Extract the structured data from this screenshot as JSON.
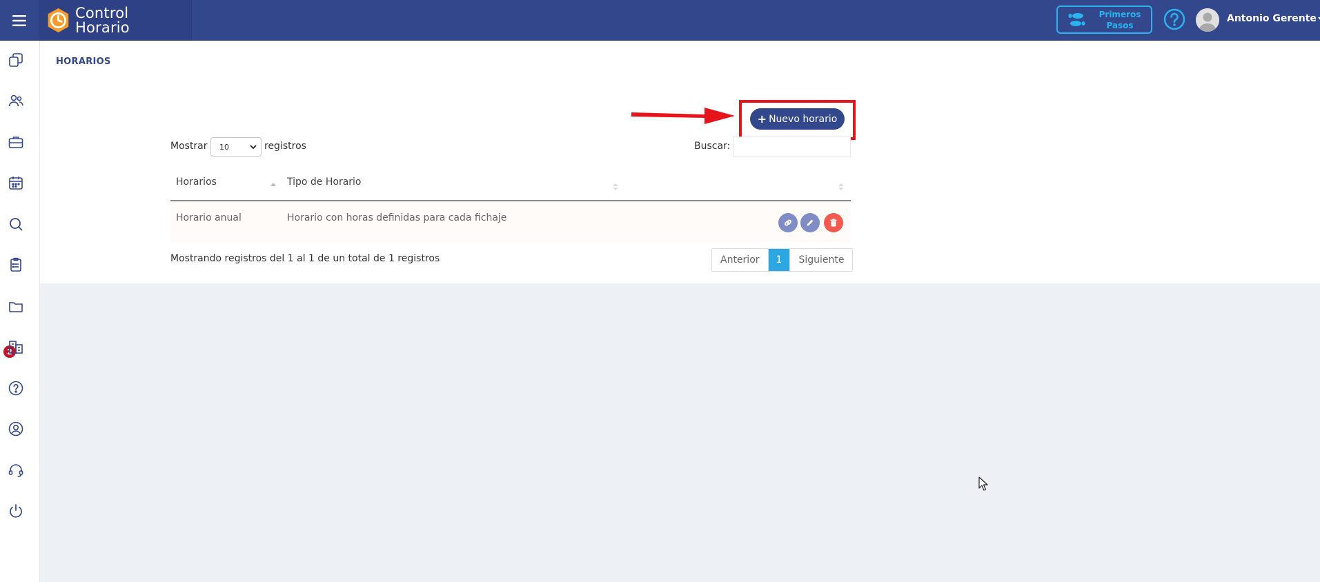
{
  "brand": {
    "line1": "Control",
    "line2": "Horario"
  },
  "header": {
    "first_steps_line1": "Primeros",
    "first_steps_line2": "Pasos",
    "user_name": "Antonio Gerente"
  },
  "sidebar": {
    "notification_badge": "2"
  },
  "page": {
    "title": "HORARIOS",
    "new_button_label": "Nuevo horario",
    "length_prefix": "Mostrar",
    "length_value": "10",
    "length_suffix": "registros",
    "search_label": "Buscar:"
  },
  "table": {
    "columns": [
      "Horarios",
      "Tipo de Horario",
      ""
    ],
    "rows": [
      {
        "name": "Horario anual",
        "type": "Horario con horas definidas para cada fichaje"
      }
    ]
  },
  "footer": {
    "info": "Mostrando registros del 1 al 1 de un total de 1 registros",
    "prev": "Anterior",
    "current_page": "1",
    "next": "Siguiente"
  },
  "colors": {
    "primary": "#33478c",
    "accent": "#29b4f0",
    "danger": "#f05a4f",
    "highlight": "#e8141b",
    "page_active": "#2ca7e0"
  }
}
